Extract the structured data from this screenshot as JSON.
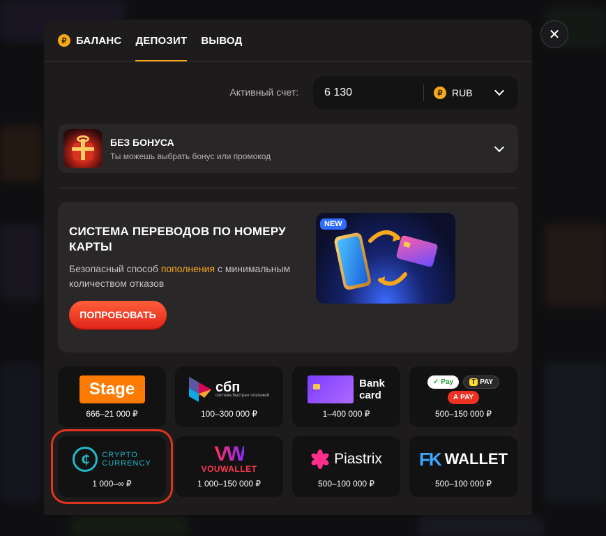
{
  "tabs": [
    {
      "label": "БАЛАНС",
      "icon": "ruble-coin-icon"
    },
    {
      "label": "ДЕПОЗИТ",
      "active": true
    },
    {
      "label": "ВЫВОД"
    }
  ],
  "coin_symbol": "₽",
  "account": {
    "label": "Активный счет:",
    "value": "6 130",
    "currency": "RUB"
  },
  "bonus": {
    "title": "БЕЗ БОНУСА",
    "subtitle": "Ты можешь выбрать бонус или промокод"
  },
  "promo": {
    "title": "СИСТЕМА ПЕРЕВОДОВ ПО НОМЕРУ КАРТЫ",
    "desc_before": "Безопасный способ ",
    "desc_highlight": "пополнения",
    "desc_after": " с минимальным количеством отказов",
    "button": "ПОПРОБОВАТЬ",
    "badge": "NEW"
  },
  "methods": [
    {
      "name": "Stage",
      "range": "666–21 000 ₽"
    },
    {
      "name": "сбп",
      "sub": "система быстрых платежей",
      "range": "100–300 000 ₽"
    },
    {
      "name": "Bank card",
      "line1": "Bank",
      "line2": "card",
      "range": "1–400 000 ₽"
    },
    {
      "name": "Pay",
      "pills": [
        "Pay",
        "PAY",
        "PAY"
      ],
      "range": "500–150 000 ₽"
    },
    {
      "name": "Crypto Currency",
      "line1": "CRYPTO",
      "line2": "CURRENCY",
      "range": "1 000–∞ ₽",
      "selected": true
    },
    {
      "name": "VOUWALLET",
      "range": "1 000–150 000 ₽"
    },
    {
      "name": "Piastrix",
      "range": "500–100 000 ₽"
    },
    {
      "name": "FK WALLET",
      "mark": "FK",
      "word": "WALLET",
      "range": "500–100 000 ₽"
    }
  ],
  "colors": {
    "accent": "#f7a81b",
    "cta": "#e2261a",
    "selected_outline": "#e0341f"
  }
}
